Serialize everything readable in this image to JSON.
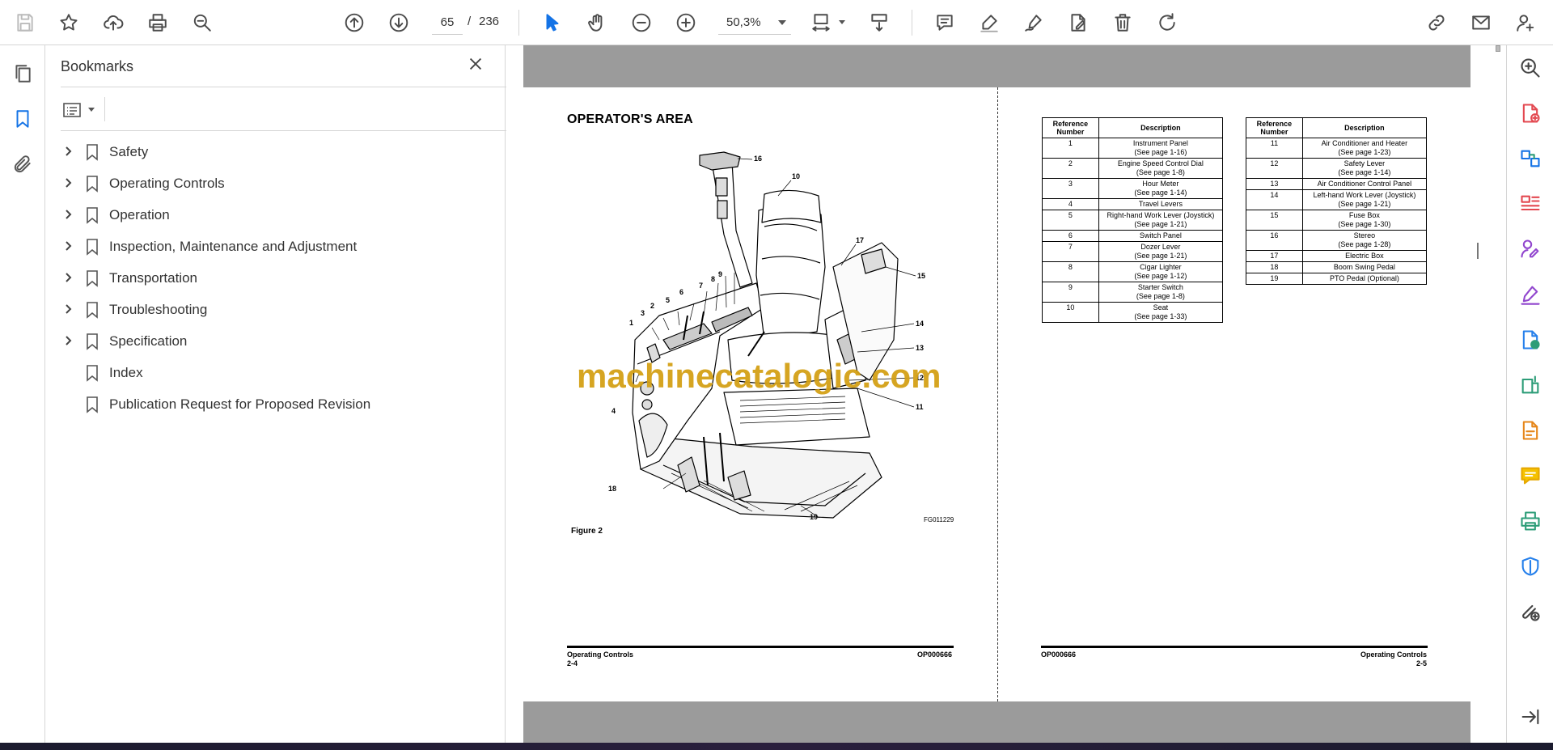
{
  "toolbar": {
    "page_current": "65",
    "page_separator": "/",
    "page_total": "236",
    "zoom": "50,3%"
  },
  "panel": {
    "title": "Bookmarks",
    "bookmarks": [
      {
        "label": "Safety",
        "expandable": true
      },
      {
        "label": "Operating Controls",
        "expandable": true
      },
      {
        "label": "Operation",
        "expandable": true
      },
      {
        "label": "Inspection, Maintenance and Adjustment",
        "expandable": true
      },
      {
        "label": "Transportation",
        "expandable": true
      },
      {
        "label": "Troubleshooting",
        "expandable": true
      },
      {
        "label": "Specification",
        "expandable": true
      },
      {
        "label": "Index",
        "expandable": false
      },
      {
        "label": "Publication Request for Proposed Revision",
        "expandable": false
      }
    ]
  },
  "document": {
    "left_page": {
      "title": "OPERATOR'S AREA",
      "figure_caption": "Figure 2",
      "figure_code": "FG011229",
      "footer_left_1": "Operating Controls",
      "footer_left_2": "2-4",
      "footer_right": "OP000666",
      "callouts": [
        "1",
        "2",
        "3",
        "4",
        "5",
        "6",
        "7",
        "8",
        "9",
        "10",
        "11",
        "12",
        "13",
        "14",
        "15",
        "16",
        "17",
        "18",
        "19"
      ]
    },
    "right_page": {
      "footer_left": "OP000666",
      "footer_right_1": "Operating Controls",
      "footer_right_2": "2-5",
      "table_headers": [
        "Reference Number",
        "Description"
      ],
      "table1": [
        {
          "num": "1",
          "desc": "Instrument Panel",
          "sub": "(See page 1-16)"
        },
        {
          "num": "2",
          "desc": "Engine Speed Control Dial",
          "sub": "(See page 1-8)"
        },
        {
          "num": "3",
          "desc": "Hour Meter",
          "sub": "(See page 1-14)"
        },
        {
          "num": "4",
          "desc": "Travel Levers",
          "sub": ""
        },
        {
          "num": "5",
          "desc": "Right-hand Work Lever (Joystick)",
          "sub": "(See page 1-21)"
        },
        {
          "num": "6",
          "desc": "Switch Panel",
          "sub": ""
        },
        {
          "num": "7",
          "desc": "Dozer Lever",
          "sub": "(See page 1-21)"
        },
        {
          "num": "8",
          "desc": "Cigar Lighter",
          "sub": "(See page 1-12)"
        },
        {
          "num": "9",
          "desc": "Starter Switch",
          "sub": "(See page 1-8)"
        },
        {
          "num": "10",
          "desc": "Seat",
          "sub": "(See page 1-33)"
        }
      ],
      "table2": [
        {
          "num": "11",
          "desc": "Air Conditioner and Heater",
          "sub": "(See page 1-23)"
        },
        {
          "num": "12",
          "desc": "Safety Lever",
          "sub": "(See page 1-14)"
        },
        {
          "num": "13",
          "desc": "Air Conditioner Control Panel",
          "sub": ""
        },
        {
          "num": "14",
          "desc": "Left-hand Work Lever (Joystick)",
          "sub": "(See page 1-21)"
        },
        {
          "num": "15",
          "desc": "Fuse Box",
          "sub": "(See page 1-30)"
        },
        {
          "num": "16",
          "desc": "Stereo",
          "sub": "(See page 1-28)"
        },
        {
          "num": "17",
          "desc": "Electric Box",
          "sub": ""
        },
        {
          "num": "18",
          "desc": "Boom Swing Pedal",
          "sub": ""
        },
        {
          "num": "19",
          "desc": "PTO Pedal (Optional)",
          "sub": ""
        }
      ]
    },
    "watermark": "machinecatalogic.com"
  },
  "icons": {
    "toolbar": [
      "save-icon",
      "star-icon",
      "upload-icon",
      "print-icon",
      "zoom-search-icon",
      "prev-page-icon",
      "next-page-icon",
      "select-cursor-icon",
      "hand-tool-icon",
      "zoom-out-icon",
      "zoom-in-icon",
      "page-fit-icon",
      "scroll-mode-icon",
      "comment-icon",
      "highlight-icon",
      "sign-icon",
      "edit-pdf-icon",
      "delete-icon",
      "rotate-icon",
      "share-link-icon",
      "email-icon",
      "add-user-icon"
    ],
    "left_rail": [
      "pages-icon",
      "bookmark-icon",
      "attachment-icon"
    ],
    "right_rail": [
      "search-zoom-icon",
      "export-pdf-icon",
      "create-pdf-icon",
      "organize-pages-icon",
      "request-signature-icon",
      "fill-sign-icon",
      "send-review-icon",
      "compress-icon",
      "scan-ocr-icon",
      "comment-tool-icon",
      "print-production-icon",
      "protect-icon",
      "more-tools-icon",
      "collapse-panel-icon"
    ]
  },
  "colors": {
    "accent": "#1473e6",
    "watermark": "#d4a117",
    "page_band": "#9b9b9b"
  }
}
